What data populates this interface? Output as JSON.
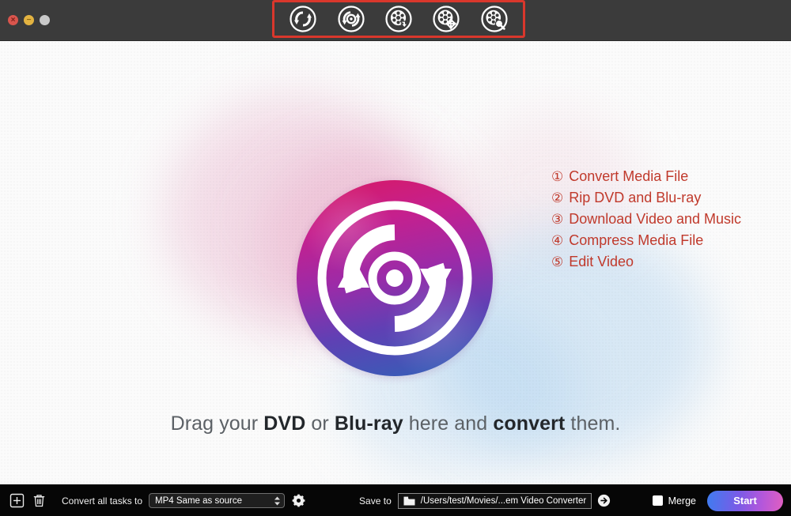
{
  "window": {
    "controls": [
      {
        "name": "close",
        "glyph": "×"
      },
      {
        "name": "minimize",
        "glyph": "−"
      },
      {
        "name": "maximize",
        "glyph": ""
      }
    ]
  },
  "toolbar": {
    "highlight_color": "#d9372c",
    "buttons": [
      {
        "icon": "convert-media-icon",
        "callout": "①"
      },
      {
        "icon": "rip-disc-icon",
        "callout": "②"
      },
      {
        "icon": "download-reel-icon",
        "callout": "③"
      },
      {
        "icon": "compress-reel-icon",
        "callout": "④"
      },
      {
        "icon": "edit-reel-icon",
        "callout": "⑤"
      }
    ],
    "callouts": [
      "①",
      "②",
      "③",
      "④",
      "⑤"
    ]
  },
  "annotations": {
    "color": "#c0392b",
    "items": [
      {
        "num": "①",
        "label": "Convert Media File"
      },
      {
        "num": "②",
        "label": "Rip DVD and Blu-ray"
      },
      {
        "num": "③",
        "label": "Download Video and Music"
      },
      {
        "num": "④",
        "label": "Compress Media File"
      },
      {
        "num": "⑤",
        "label": "Edit Video"
      }
    ]
  },
  "main": {
    "logo_alt": "video-converter-logo",
    "drag_hint": {
      "part1": "Drag your ",
      "strong1": "DVD",
      "part2": " or ",
      "strong2": "Blu-ray",
      "part3": " here and ",
      "strong3": "convert",
      "part4": " them."
    }
  },
  "bottombar": {
    "add_icon": "add-task-icon",
    "delete_icon": "delete-task-icon",
    "convert_all_label": "Convert all tasks to",
    "format_select": {
      "value": "MP4 Same as source",
      "options": [
        "MP4 Same as source"
      ]
    },
    "settings_icon": "gear-icon",
    "save_to_label": "Save to",
    "save_path": "/Users/test/Movies/...em Video Converter",
    "folder_icon": "folder-icon",
    "open_icon": "arrow-right-icon",
    "merge_label": "Merge",
    "merge_checked": false,
    "start_label": "Start",
    "start_gradient": [
      "#3f7cf0",
      "#b457db",
      "#e05fc0"
    ]
  }
}
